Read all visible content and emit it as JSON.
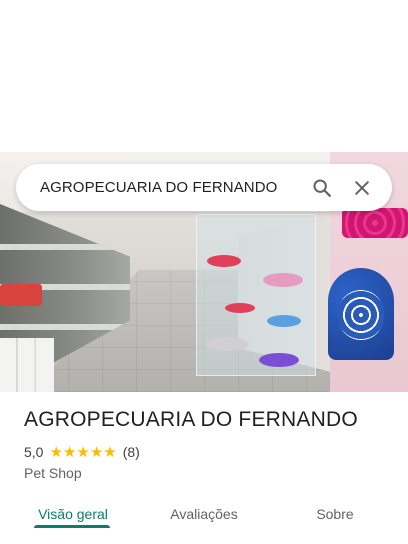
{
  "search": {
    "query": "AGROPECUARIA DO FERNANDO",
    "search_icon": "search-icon",
    "clear_icon": "close-icon"
  },
  "place": {
    "name": "AGROPECUARIA DO FERNANDO",
    "rating": "5,0",
    "stars": 5,
    "review_count": "(8)",
    "category": "Pet Shop"
  },
  "tabs": [
    {
      "label": "Visão geral",
      "active": true
    },
    {
      "label": "Avaliações",
      "active": false
    },
    {
      "label": "Sobre",
      "active": false
    }
  ],
  "colors": {
    "accent": "#0b7d6a",
    "star": "#fbbc04"
  }
}
